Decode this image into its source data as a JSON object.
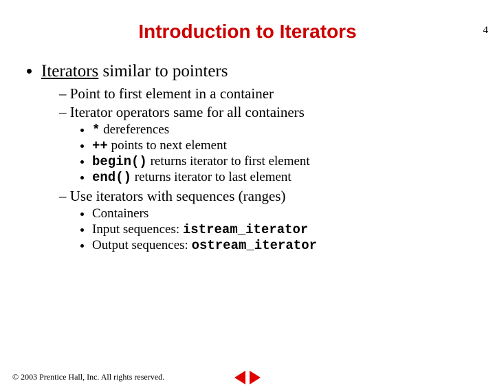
{
  "page_number": "4",
  "title": "Introduction to Iterators",
  "bullet_main_strong": "Iterators",
  "bullet_main_rest": " similar to pointers",
  "sub1": "Point to first element in a container",
  "sub2": "Iterator operators same for all containers",
  "op_star_code": "*",
  "op_star_text": " dereferences",
  "op_pp_code": "++",
  "op_pp_text": " points to next element",
  "op_begin_code": "begin()",
  "op_begin_text": " returns iterator to first element",
  "op_end_code": "end()",
  "op_end_text": " returns iterator to last element",
  "sub3": "Use iterators with sequences (ranges)",
  "seq1": "Containers",
  "seq2_text": "Input sequences: ",
  "seq2_code": "istream_iterator",
  "seq3_text": "Output sequences: ",
  "seq3_code": "ostream_iterator",
  "copyright": "© 2003 Prentice Hall, Inc.  All rights reserved."
}
